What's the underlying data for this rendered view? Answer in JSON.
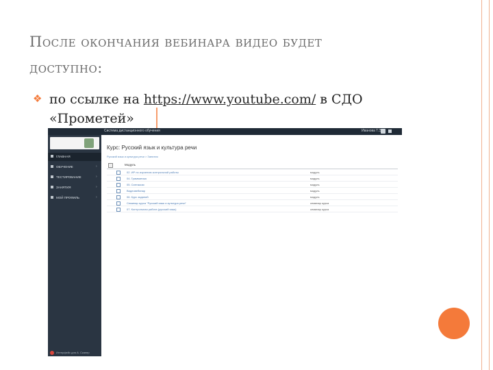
{
  "slide": {
    "title_line1": "После окончания вебинара видео будет",
    "title_line2": "доступно:",
    "bullet_prefix": "по ссылке на ",
    "bullet_link": "https://www.youtube.com/",
    "bullet_suffix": " в СДО",
    "bullet_line2": "«Прометей»",
    "bullet_icon": "diamond-bullet-icon",
    "accent_color": "#f47a3a"
  },
  "screenshot": {
    "site_title": "Система дистанционного обучения",
    "user_name": "Иванова Т.Э.",
    "sidebar_items": [
      {
        "label": "ГЛАВНАЯ",
        "active": true
      },
      {
        "label": "ОБУЧЕНИЕ",
        "active": false
      },
      {
        "label": "ТЕСТИРОВАНИЕ",
        "active": false
      },
      {
        "label": "ЗАНЯТИЯ",
        "active": false
      },
      {
        "label": "МОЙ ПРОФИЛЬ",
        "active": false
      }
    ],
    "sidebar_footer": "Интерфейс для А. Сканер",
    "course_title": "Курс: Русский язык и культура речи",
    "breadcrumb": "Русский язык и культура речи > Занятия",
    "table_header": "Модуль",
    "rows": [
      {
        "name": "02. ИР по изучению контрольной работы",
        "type": "модуль"
      },
      {
        "name": "04. Грамматика",
        "type": "модуль"
      },
      {
        "name": "05. Синтаксис",
        "type": "модуль"
      },
      {
        "name": "Видеовебинар",
        "type": "модуль"
      },
      {
        "name": "06. Курс заданий",
        "type": "модуль"
      },
      {
        "name": "Семинар курса \"Русский язык и культура речи\"",
        "type": "семинар курса"
      },
      {
        "name": "07. Контрольная работа (русский язык)",
        "type": "семинар курса"
      }
    ]
  }
}
